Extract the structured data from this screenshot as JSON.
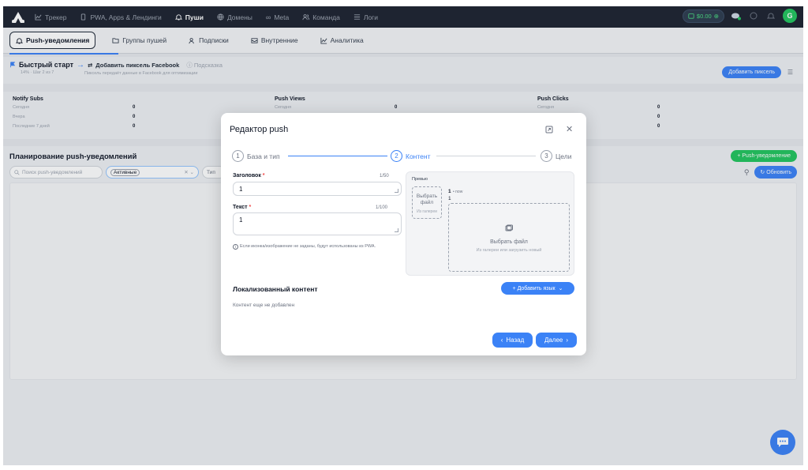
{
  "topnav": {
    "items": [
      {
        "label": "Трекер",
        "icon": "chart-line-icon"
      },
      {
        "label": "PWA, Apps & Лендинги",
        "icon": "phone-icon"
      },
      {
        "label": "Пуши",
        "icon": "bell-icon",
        "active": true
      },
      {
        "label": "Домены",
        "icon": "globe-icon"
      },
      {
        "label": "Meta",
        "icon": "infinity-icon"
      },
      {
        "label": "Команда",
        "icon": "users-icon"
      },
      {
        "label": "Логи",
        "icon": "list-icon"
      }
    ],
    "balance": "$0.00",
    "avatar_initial": "G"
  },
  "subtabs": [
    {
      "label": "Push-уведомления",
      "icon": "bell-icon",
      "active": true
    },
    {
      "label": "Группы пушей",
      "icon": "folder-icon"
    },
    {
      "label": "Подписки",
      "icon": "users-icon"
    },
    {
      "label": "Внутренние",
      "icon": "inbox-icon"
    },
    {
      "label": "Аналитика",
      "icon": "chart-line-icon"
    }
  ],
  "quickstart": {
    "title": "Быстрый старт",
    "step": "14% · Шаг 2 из 7",
    "action": "Добавить пиксель Facebook",
    "hint": "Подсказка",
    "sub": "Пиксель передаёт данные в Facebook для оптимизации",
    "button": "Добавить пиксель"
  },
  "stats": {
    "rows": [
      "Сегодня",
      "Вчера",
      "Последние 7 дней"
    ],
    "columns": [
      {
        "title": "Notify Subs",
        "values": [
          "0",
          "0",
          "0"
        ]
      },
      {
        "title": "Push Views",
        "values": [
          "0",
          "0",
          "0"
        ]
      },
      {
        "title": "Push Clicks",
        "values": [
          "0",
          "0",
          "0"
        ]
      }
    ]
  },
  "planning": {
    "title": "Планирование push-уведомлений",
    "add_button": "+ Push-уведомление",
    "search_placeholder": "Поиск push-уведомлений",
    "status_value": "Активные",
    "type_placeholder": "Тип",
    "refresh": "Обновить"
  },
  "modal": {
    "title": "Редактор push",
    "steps": [
      {
        "num": "1",
        "label": "База и тип"
      },
      {
        "num": "2",
        "label": "Контент",
        "active": true
      },
      {
        "num": "3",
        "label": "Цели"
      }
    ],
    "heading_label": "Заголовок",
    "heading_count": "1/50",
    "heading_value": "1",
    "text_label": "Текст",
    "text_count": "1/100",
    "text_value": "1",
    "info_note": "Если иконка/изображение не заданы, будут использованы из PWA.",
    "preview": {
      "label": "Превью",
      "icon_slot_title": "Выбрать файл",
      "icon_slot_sub": "Из галереи",
      "title": "1",
      "time": "• now",
      "text": "1",
      "image_slot_title": "Выбрать файл",
      "image_slot_sub": "Из галереи или загрузить новый"
    },
    "localized": {
      "title": "Локализованный контент",
      "add_button": "+ Добавить язык",
      "empty": "Контент еще не добавлен"
    },
    "back_button": "Назад",
    "next_button": "Далее"
  },
  "colors": {
    "accent": "#3b82f6",
    "success": "#22c55e",
    "nav_bg": "#1d2330"
  }
}
